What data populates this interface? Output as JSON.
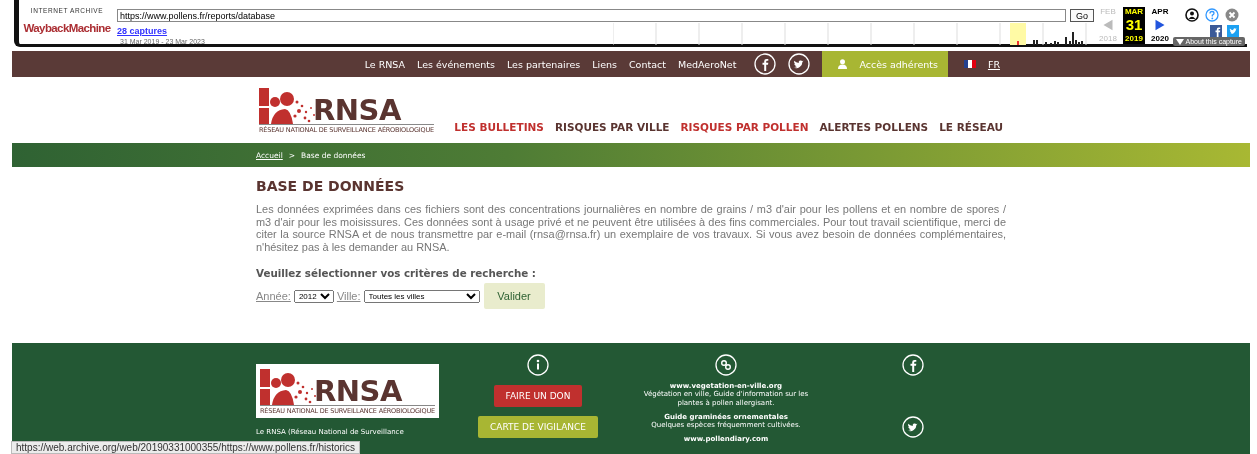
{
  "wayback": {
    "archive_label": "INTERNET ARCHIVE",
    "logo": "WaybackMachine",
    "url": "https://www.pollens.fr/reports/database",
    "go": "Go",
    "captures": "28 captures",
    "range": "31 Mar 2019 - 23 Mar 2023",
    "calendar": [
      {
        "month": "FEB",
        "year": "2018",
        "kind": "prev",
        "selected": false
      },
      {
        "month": "MAR",
        "day": "31",
        "year": "2019",
        "kind": "current",
        "selected": true
      },
      {
        "month": "APR",
        "year": "2020",
        "kind": "next",
        "selected": false
      }
    ],
    "about": "About this capture"
  },
  "top_nav": {
    "links": [
      "Le RNSA",
      "Les événements",
      "Les partenaires",
      "Liens",
      "Contact",
      "MedAeroNet"
    ],
    "members": "Accès adhérents",
    "language": "FR"
  },
  "logo": {
    "name": "RNSA",
    "subtitle": "RÉSEAU NATIONAL DE SURVEILLANCE AÉROBIOLOGIQUE"
  },
  "main_nav": [
    {
      "label": "LES BULLETINS",
      "color": "#c0302e"
    },
    {
      "label": "RISQUES PAR VILLE",
      "color": "#5a3430"
    },
    {
      "label": "RISQUES PAR POLLEN",
      "color": "#c0302e"
    },
    {
      "label": "ALERTES POLLENS",
      "color": "#5a3430"
    },
    {
      "label": "LE RÉSEAU",
      "color": "#5a3430"
    }
  ],
  "breadcrumb": {
    "items": [
      "Accueil",
      "Base de données"
    ],
    "separator": ">"
  },
  "content": {
    "title": "BASE DE DONNÉES",
    "text": "Les données exprimées dans ces fichiers sont des concentrations journalières en nombre de grains / m3 d'air pour les pollens et en nombre de spores / m3 d'air pour les moisissures. Ces données sont à usage privé et ne peuvent être utilisées à des fins commerciales. Pour tout travail scientifique, merci de citer la source RNSA et de nous transmettre par e-mail (rnsa@rnsa.fr) un exemplaire de vos travaux. Si vous avez besoin de données complémentaires, n'hésitez pas à les demander au RNSA.",
    "criteria": "Veuillez sélectionner vos critères de recherche :",
    "year_label": "Année:",
    "year": "2012",
    "city_label": "Ville:",
    "city": "Toutes les villes",
    "submit": "Valider"
  },
  "footer": {
    "logo": {
      "name": "RNSA",
      "subtitle": "RÉSEAU NATIONAL DE SURVEILLANCE AÉROBIOLOGIQUE"
    },
    "about": "Le RNSA (Réseau National de Surveillance",
    "buttons": [
      {
        "label": "FAIRE UN DON",
        "kind": "donate"
      },
      {
        "label": "CARTE DE VIGILANCE",
        "kind": "map"
      }
    ],
    "links": [
      {
        "title": "www.vegetation-en-ville.org",
        "description": "Végétation en ville, Guide d'information sur les plantes à pollen allergisant."
      },
      {
        "title": "Guide graminées ornementales",
        "description": "Quelques espèces fréquemment cultivées."
      },
      {
        "title": "www.pollendiary.com"
      }
    ]
  },
  "status_bar": "https://web.archive.org/web/20190331000355/https://www.pollens.fr/historics"
}
